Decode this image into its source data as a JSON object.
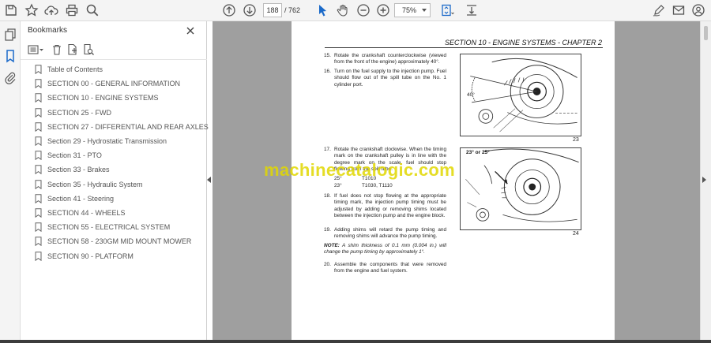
{
  "toolbar": {
    "current_page": "188",
    "total_pages": "/ 762",
    "zoom": "75%"
  },
  "panel": {
    "title": "Bookmarks"
  },
  "bookmarks": [
    "Table of Contents",
    "SECTION 00 - GENERAL INFORMATION",
    "SECTION 10 - ENGINE SYSTEMS",
    "SECTION 25 - FWD",
    "SECTION 27 - DIFFERENTIAL AND REAR AXLES",
    "Section 29 - Hydrostatic Transmission",
    "Section 31 - PTO",
    "Section 33 - Brakes",
    "Section 35 - Hydraulic System",
    "Section 41 - Steering",
    "SECTION 44 - WHEELS",
    "SECTION 55 - ELECTRICAL SYSTEM",
    "SECTION 58 - 230GM MID MOUNT MOWER",
    "SECTION 90 - PLATFORM"
  ],
  "document": {
    "header": "SECTION 10 - ENGINE SYSTEMS - CHAPTER 2",
    "step15_num": "15.",
    "step15": "Rotate the crankshaft counterclockwise (viewed from the front of the engine) approximately 40°.",
    "step16_num": "16.",
    "step16": "Turn on the fuel supply to the injection pump. Fuel should flow out of the spill tube on the No. 1 cylinder port.",
    "step17_num": "17.",
    "step17": "Rotate the crankshaft clockwise. When the timing mark on the crankshaft pulley is in line with the degree mark on the scale, fuel should stop flowing from the spill tube.",
    "spec1_deg": "25°",
    "spec1_model": "T1010",
    "spec2_deg": "23°",
    "spec2_model": "T1030, T1110",
    "step18_num": "18.",
    "step18": "If fuel does not stop flowing at the appropriate timing mark, the injection pump timing must be adjusted by adding or removing shims located between the injection pump and the engine block.",
    "step19_num": "19.",
    "step19": "Adding shims will retard the pump timing and removing shims will advance the pump timing.",
    "note_label": "NOTE:",
    "note": "A shim thickness of 0.1 mm (0.004 in.) will change the pump timing by approximately 1°.",
    "step20_num": "20.",
    "step20": "Assemble the components that were removed from the engine and fuel system.",
    "fig23_label": "40°",
    "fig23_num": "23",
    "fig24_label": "23° or 25°",
    "fig24_num": "24"
  },
  "watermark": "machinecatalogic.com",
  "colors": {
    "toolbar_bg": "#f4f4f4",
    "doc_bg": "#9f9f9f",
    "accent_blue": "#1b6ac9",
    "watermark": "#e1d700"
  }
}
